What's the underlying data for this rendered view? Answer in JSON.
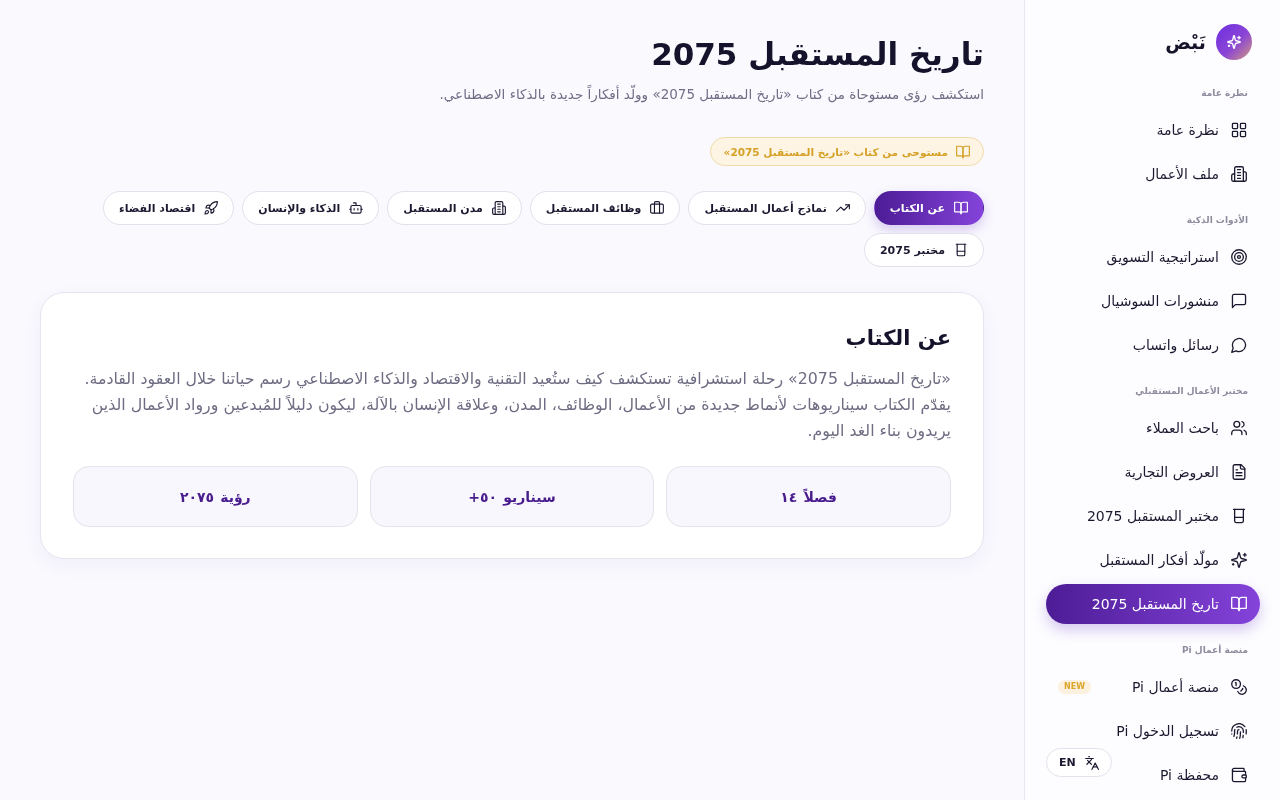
{
  "brand": {
    "name": "نَبْض"
  },
  "sidebar": {
    "sections": [
      {
        "title": "نظرة عامة",
        "items": [
          {
            "label": "نظرة عامة",
            "selected": false
          },
          {
            "label": "ملف الأعمال",
            "selected": false
          }
        ]
      },
      {
        "title": "الأدوات الذكية",
        "items": [
          {
            "label": "استراتيجية التسويق",
            "selected": false
          },
          {
            "label": "منشورات السوشيال",
            "selected": false
          },
          {
            "label": "رسائل واتساب",
            "selected": false
          }
        ]
      },
      {
        "title": "مختبر الأعمال المستقبلي",
        "items": [
          {
            "label": "باحث العملاء",
            "selected": false
          },
          {
            "label": "العروض التجارية",
            "selected": false
          },
          {
            "label": "مختبر المستقبل 2075",
            "selected": false
          },
          {
            "label": "مولّد أفكار المستقبل",
            "selected": false
          },
          {
            "label": "تاريخ المستقبل 2075",
            "selected": true
          }
        ]
      },
      {
        "title": "منصة أعمال Pi",
        "items": [
          {
            "label": "منصة أعمال Pi",
            "selected": false,
            "badge": "NEW"
          },
          {
            "label": "تسجيل الدخول Pi",
            "selected": false
          },
          {
            "label": "محفظة Pi",
            "selected": false
          }
        ]
      }
    ]
  },
  "language_button": {
    "label": "EN"
  },
  "header": {
    "title": "تاريخ المستقبل 2075",
    "subtitle": "استكشف رؤى مستوحاة من كتاب «تاريخ المستقبل 2075» وولّد أفكاراً جديدة بالذكاء الاصطناعي."
  },
  "source_tag": {
    "label": "مستوحى من كتاب «تاريخ المستقبل 2075»"
  },
  "tabs": [
    {
      "label": "عن الكتاب",
      "selected": true
    },
    {
      "label": "نماذج أعمال المستقبل",
      "selected": false
    },
    {
      "label": "وظائف المستقبل",
      "selected": false
    },
    {
      "label": "مدن المستقبل",
      "selected": false
    },
    {
      "label": "الذكاء والإنسان",
      "selected": false
    },
    {
      "label": "اقتصاد الفضاء",
      "selected": false
    },
    {
      "label": "مختبر 2075",
      "selected": false
    }
  ],
  "about_card": {
    "title": "عن الكتاب",
    "body": "«تاريخ المستقبل 2075» رحلة استشرافية تستكشف كيف ستُعيد التقنية والاقتصاد والذكاء الاصطناعي رسم حياتنا خلال العقود القادمة. يقدّم الكتاب سيناريوهات لأنماط جديدة من الأعمال، الوظائف، المدن، وعلاقة الإنسان بالآلة، ليكون دليلاً للمُبدعين ورواد الأعمال الذين يريدون بناء الغد اليوم.",
    "stats": [
      {
        "value": "١٤",
        "label": "فصلاً"
      },
      {
        "value": "+٥٠",
        "label": "سيناريو"
      },
      {
        "value": "٢٠٧٥",
        "label": "رؤية"
      }
    ]
  }
}
